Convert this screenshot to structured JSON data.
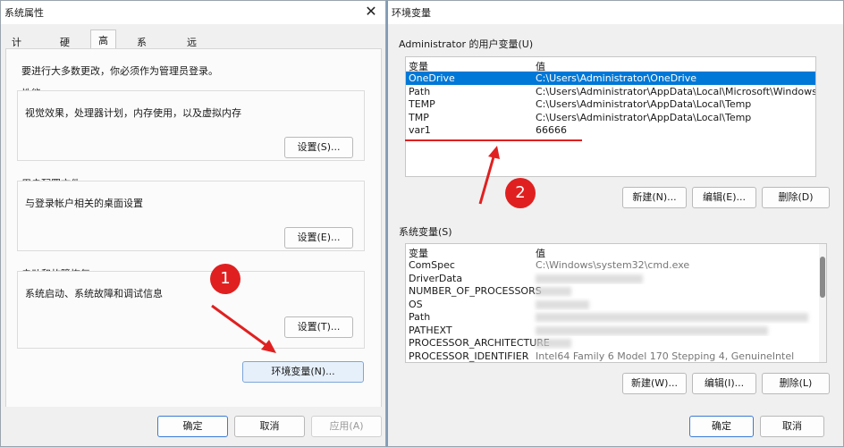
{
  "sys_props": {
    "title": "系统属性",
    "tabs": [
      "计算机名",
      "硬件",
      "高级",
      "系统保护",
      "远程"
    ],
    "admin_note": "要进行大多数更改，你必须作为管理员登录。",
    "performance": {
      "label": "性能",
      "desc": "视觉效果，处理器计划，内存使用，以及虚拟内存",
      "button": "设置(S)..."
    },
    "profiles": {
      "label": "用户配置文件",
      "desc": "与登录帐户相关的桌面设置",
      "button": "设置(E)..."
    },
    "startup": {
      "label": "启动和故障恢复",
      "desc": "系统启动、系统故障和调试信息",
      "button": "设置(T)..."
    },
    "env_button": "环境变量(N)...",
    "ok": "确定",
    "cancel": "取消",
    "apply": "应用(A)"
  },
  "env_vars": {
    "title": "环境变量",
    "user_section": "Administrator 的用户变量(U)",
    "col_var": "变量",
    "col_val": "值",
    "user_rows": [
      {
        "name": "OneDrive",
        "value": "C:\\Users\\Administrator\\OneDrive"
      },
      {
        "name": "Path",
        "value": "C:\\Users\\Administrator\\AppData\\Local\\Microsoft\\WindowsApps;"
      },
      {
        "name": "TEMP",
        "value": "C:\\Users\\Administrator\\AppData\\Local\\Temp"
      },
      {
        "name": "TMP",
        "value": "C:\\Users\\Administrator\\AppData\\Local\\Temp"
      },
      {
        "name": "var1",
        "value": "66666"
      }
    ],
    "user_new": "新建(N)...",
    "user_edit": "编辑(E)...",
    "user_delete": "删除(D)",
    "system_section": "系统变量(S)",
    "system_rows": [
      {
        "name": "ComSpec",
        "value": "C:\\Windows\\system32\\cmd.exe"
      },
      {
        "name": "DriverData",
        "value": ""
      },
      {
        "name": "NUMBER_OF_PROCESSORS",
        "value": ""
      },
      {
        "name": "OS",
        "value": ""
      },
      {
        "name": "Path",
        "value": ""
      },
      {
        "name": "PATHEXT",
        "value": ""
      },
      {
        "name": "PROCESSOR_ARCHITECTURE",
        "value": ""
      },
      {
        "name": "PROCESSOR_IDENTIFIER",
        "value": "Intel64 Family 6 Model 170 Stepping 4, GenuineIntel"
      }
    ],
    "sys_new": "新建(W)...",
    "sys_edit": "编辑(I)...",
    "sys_delete": "删除(L)",
    "ok": "确定",
    "cancel": "取消"
  },
  "annotations": {
    "badge1": "1",
    "badge2": "2",
    "color": "#e02020"
  }
}
